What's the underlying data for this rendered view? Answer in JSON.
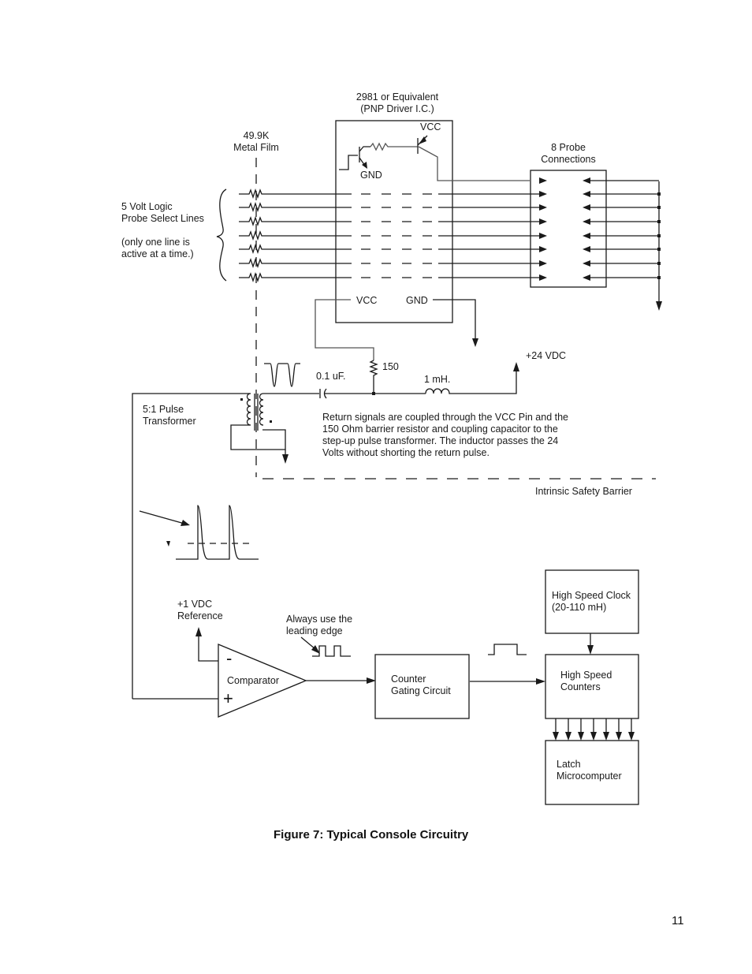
{
  "figure": {
    "caption": "Figure 7: Typical Console Circuitry",
    "page_number": "11"
  },
  "driver_ic": {
    "title_line1": "2981 or Equivalent",
    "title_line2": "(PNP Driver I.C.)",
    "vcc_top": "VCC",
    "gnd_inner": "GND",
    "vcc_pin": "VCC",
    "gnd_pin": "GND"
  },
  "resistors": {
    "label_line1": "49.9K",
    "label_line2": "Metal Film",
    "line_count": 7
  },
  "probe_select": {
    "line1": "5 Volt Logic",
    "line2": "Probe Select Lines",
    "note_line1": "(only one line is",
    "note_line2": "active at a time.)"
  },
  "probe_connections": {
    "label_line1": "8 Probe",
    "label_line2": "Connections",
    "count": 8
  },
  "barrier": {
    "resistor_value": "150",
    "capacitor_value": "0.1 uF.",
    "inductor_value": "1 mH.",
    "supply": "+24 VDC",
    "barrier_label": "Intrinsic Safety Barrier",
    "note_lines": [
      "Return signals are coupled through the VCC Pin and the",
      "150 Ohm barrier resistor and coupling capacitor to the",
      "step-up pulse transformer. The inductor passes the 24",
      "Volts without shorting the return pulse."
    ]
  },
  "transformer": {
    "label_line1": "5:1 Pulse",
    "label_line2": "Transformer"
  },
  "comparator": {
    "label": "Comparator",
    "minus": "-",
    "plus": "+",
    "reference_line1": "+1 VDC",
    "reference_line2": "Reference",
    "edge_note_line1": "Always use the",
    "edge_note_line2": "leading edge"
  },
  "blocks": {
    "gating_line1": "Counter",
    "gating_line2": "Gating Circuit",
    "clock_line1": "High Speed Clock",
    "clock_line2": "(20-110 mH)",
    "counters_line1": "High Speed",
    "counters_line2": "Counters",
    "latch_line1": "Latch",
    "latch_line2": "Microcomputer",
    "bus_lines": 7
  }
}
